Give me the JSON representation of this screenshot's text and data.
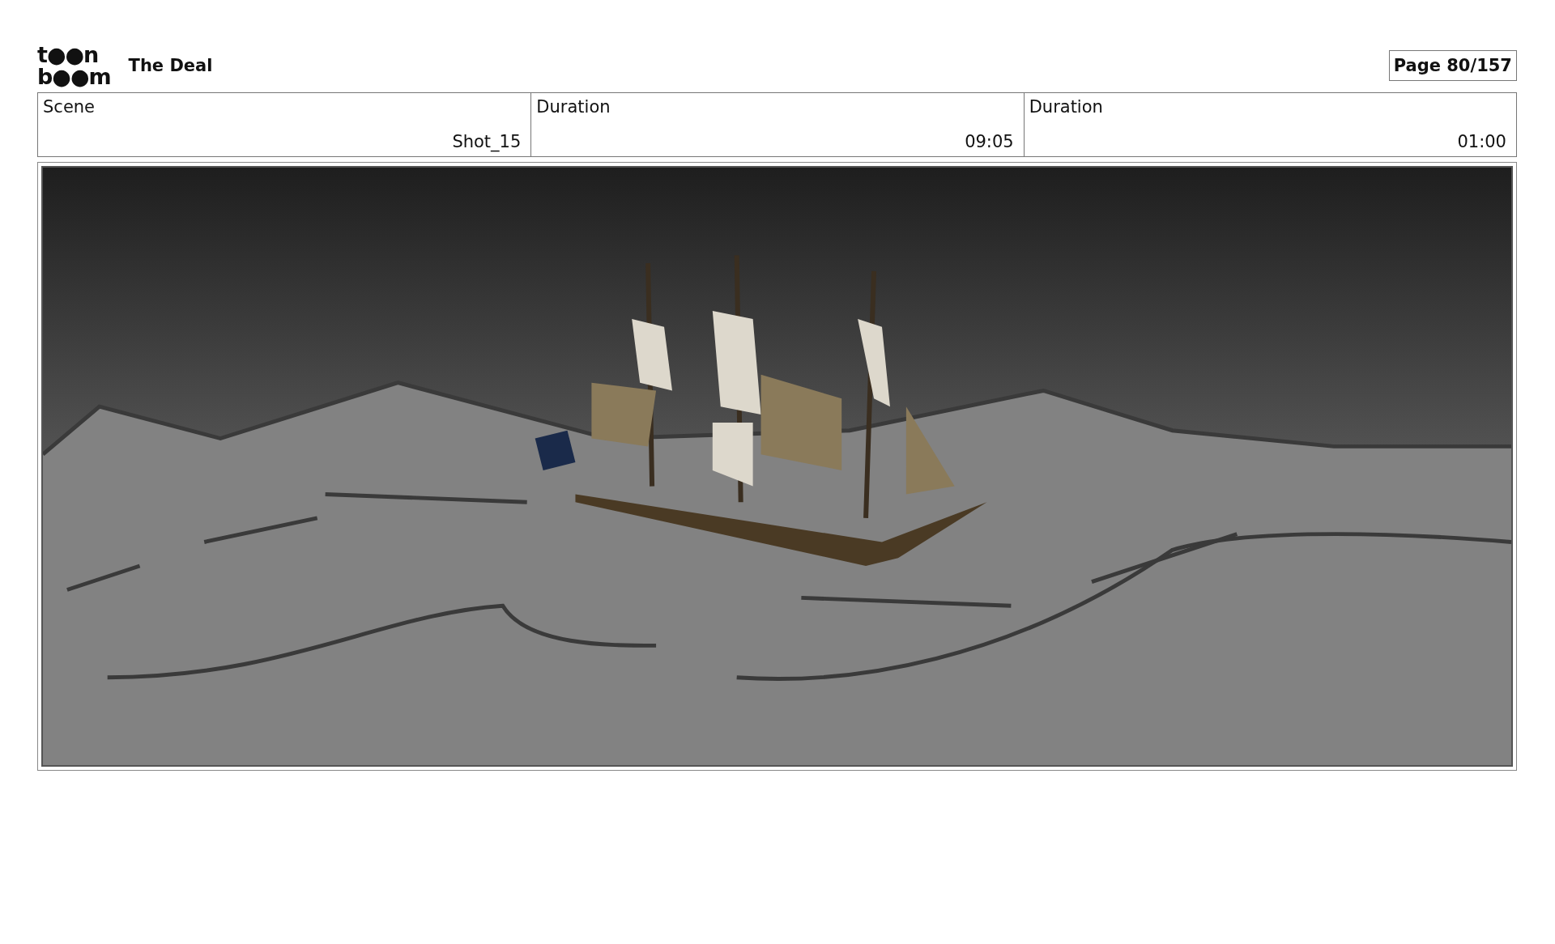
{
  "header": {
    "logo_lines": [
      "t●●n",
      "b●●m"
    ],
    "title": "The Deal",
    "page": "Page  80/157"
  },
  "fields": [
    {
      "label": "Scene",
      "value": "Shot_15"
    },
    {
      "label": "Duration",
      "value": "09:05"
    },
    {
      "label": "Duration",
      "value": "01:00"
    }
  ]
}
